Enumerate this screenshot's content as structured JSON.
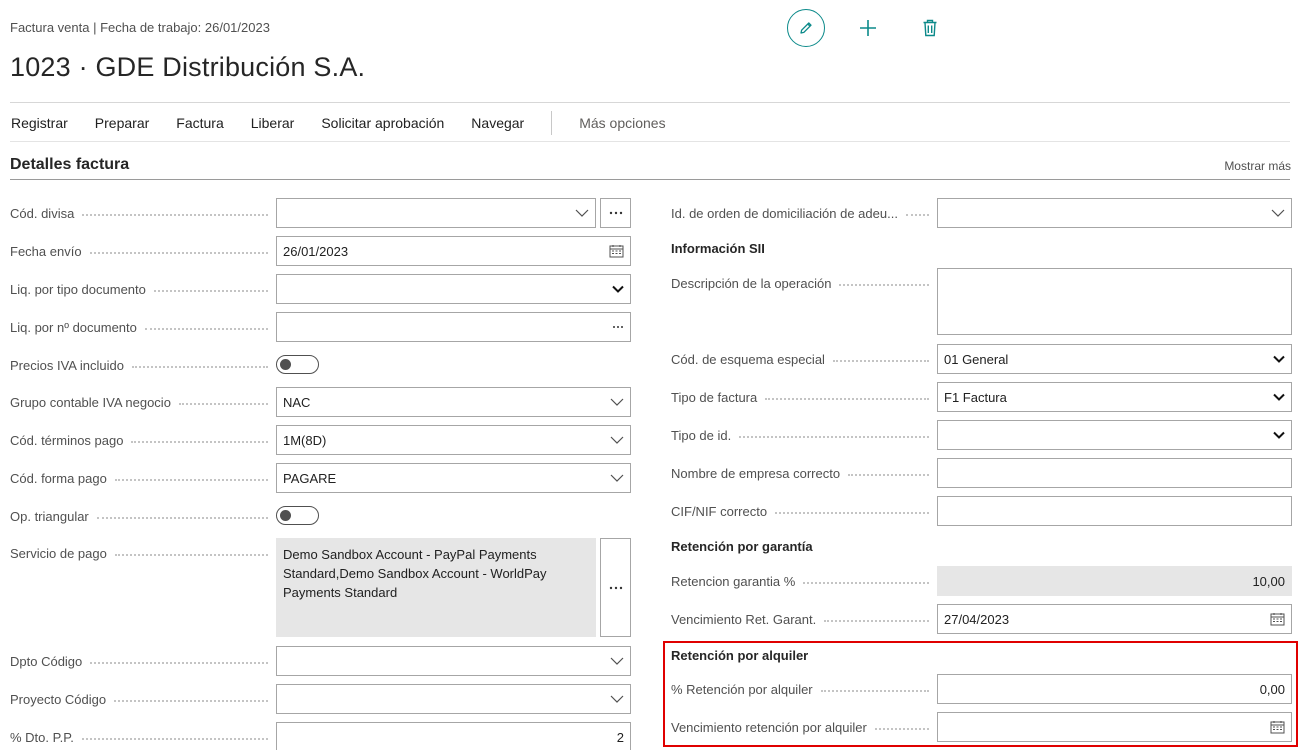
{
  "header": {
    "subtitle": "Factura venta | Fecha de trabajo: 26/01/2023",
    "title": "1023 · GDE Distribución S.A.",
    "actions": [
      "pencil-icon",
      "plus-icon",
      "trash-icon"
    ]
  },
  "menu": {
    "items": [
      "Registrar",
      "Preparar",
      "Factura",
      "Liberar",
      "Solicitar aprobación",
      "Navegar"
    ],
    "more": "Más opciones"
  },
  "section": {
    "title": "Detalles factura",
    "show_more": "Mostrar más"
  },
  "left": {
    "cod_divisa": {
      "label": "Cód. divisa",
      "value": ""
    },
    "fecha_envio": {
      "label": "Fecha envío",
      "value": "26/01/2023"
    },
    "liq_tipo": {
      "label": "Liq. por tipo documento",
      "value": ""
    },
    "liq_num": {
      "label": "Liq. por nº documento",
      "value": ""
    },
    "precios_iva": {
      "label": "Precios IVA incluido",
      "value": false
    },
    "grupo_iva": {
      "label": "Grupo contable IVA negocio",
      "value": "NAC"
    },
    "terminos_pago": {
      "label": "Cód. términos pago",
      "value": "1M(8D)"
    },
    "forma_pago": {
      "label": "Cód. forma pago",
      "value": "PAGARE"
    },
    "op_triangular": {
      "label": "Op. triangular",
      "value": false
    },
    "servicio_pago": {
      "label": "Servicio de pago",
      "value": "Demo Sandbox Account - PayPal Payments Standard,Demo Sandbox Account - WorldPay Payments Standard"
    },
    "dpto": {
      "label": "Dpto Código",
      "value": ""
    },
    "proyecto": {
      "label": "Proyecto Código",
      "value": ""
    },
    "dto_pp": {
      "label": "% Dto. P.P.",
      "value": "2"
    }
  },
  "right": {
    "domiciliacion": {
      "label": "Id. de orden de domiciliación de adeu...",
      "value": ""
    },
    "sii_head": "Información SII",
    "descripcion": {
      "label": "Descripción de la operación",
      "value": ""
    },
    "esquema": {
      "label": "Cód. de esquema especial",
      "value": "01 General"
    },
    "tipo_factura": {
      "label": "Tipo de factura",
      "value": "F1 Factura"
    },
    "tipo_id": {
      "label": "Tipo de id.",
      "value": ""
    },
    "nombre_empresa": {
      "label": "Nombre de empresa correcto",
      "value": ""
    },
    "cif": {
      "label": "CIF/NIF correcto",
      "value": ""
    },
    "garantia_head": "Retención por garantía",
    "ret_garantia": {
      "label": "Retencion garantia %",
      "value": "10,00"
    },
    "venc_garantia": {
      "label": "Vencimiento Ret. Garant.",
      "value": "27/04/2023"
    },
    "alquiler_head": "Retención por alquiler",
    "ret_alquiler": {
      "label": "% Retención por alquiler",
      "value": "0,00"
    },
    "venc_alquiler": {
      "label": "Vencimiento retención por alquiler",
      "value": ""
    }
  },
  "colors": {
    "accent": "#0c8a8a",
    "highlight": "#e00000"
  }
}
